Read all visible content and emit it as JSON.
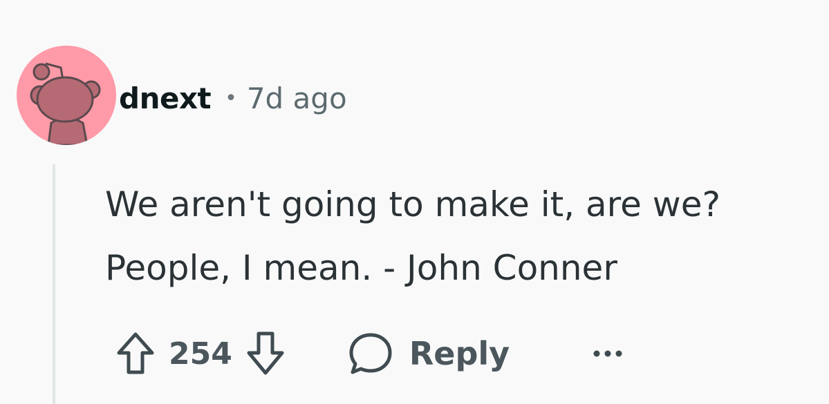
{
  "comment": {
    "username": "dnext",
    "separator": "•",
    "time": "7d ago",
    "lines": [
      "We aren't going to make it, are we?",
      "People, I mean. - John Conner"
    ],
    "votes": "254",
    "reply_label": "Reply"
  },
  "icons": {
    "avatar": "snoo-avatar",
    "upvote": "arrow-up-icon",
    "downvote": "arrow-down-icon",
    "reply": "speech-bubble-icon",
    "more": "ellipsis-icon"
  },
  "colors": {
    "background": "#f9f9f9",
    "avatar_bg": "#ff9aa8",
    "text": "#2a3236",
    "muted": "#5c6a6f"
  }
}
